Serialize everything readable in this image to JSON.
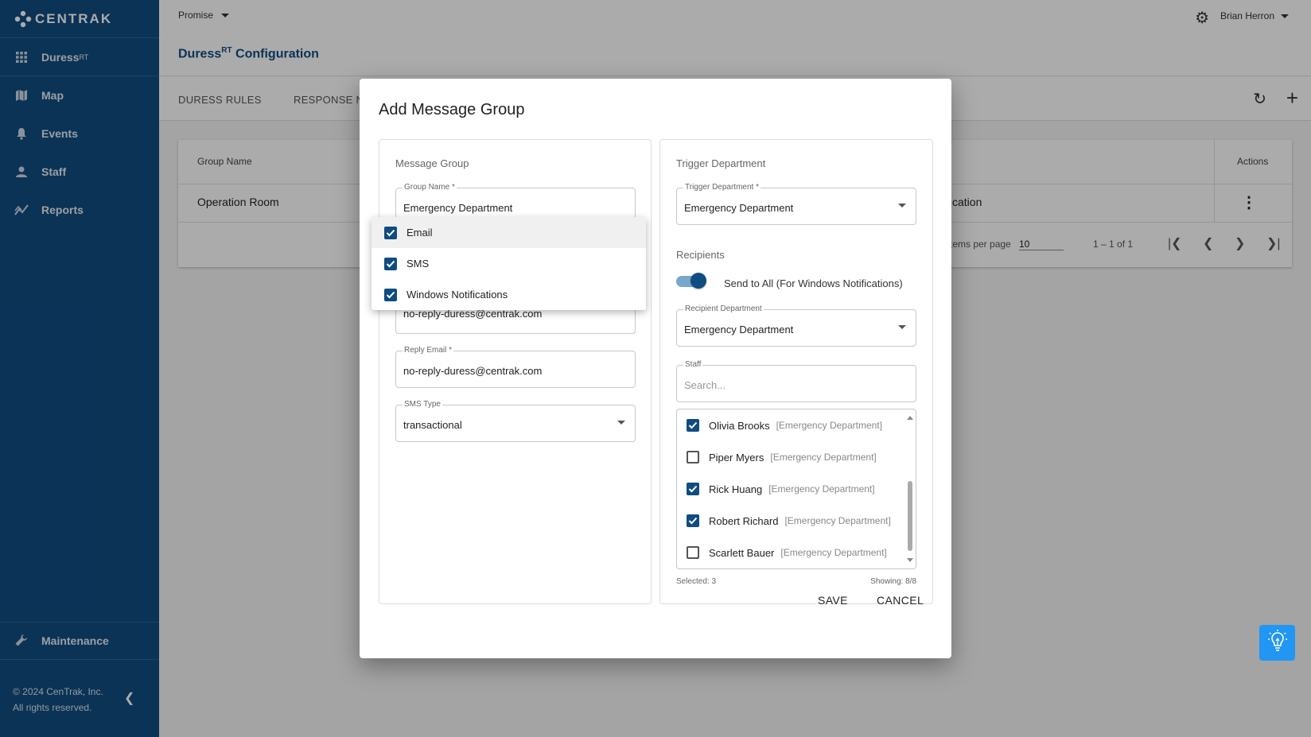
{
  "app": {
    "logo_text": "CENTRAK",
    "site": "Promise",
    "page_title": "Duress",
    "page_title_sup": "RT",
    "page_title_rest": " Configuration",
    "user": "Brian Herron"
  },
  "sidebar": {
    "items": [
      {
        "label": "Duress",
        "sup": "RT",
        "icon": "grid-icon"
      },
      {
        "label": "Map",
        "icon": "map-icon"
      },
      {
        "label": "Events",
        "icon": "bell-icon"
      },
      {
        "label": "Staff",
        "icon": "person-icon"
      },
      {
        "label": "Reports",
        "icon": "chart-icon"
      }
    ],
    "maintenance": "Maintenance",
    "copyright_line1": "© 2024 CenTrak, Inc.",
    "copyright_line2": "All rights reserved."
  },
  "tabs": [
    "DURESS RULES",
    "RESPONSE N"
  ],
  "table": {
    "headers": {
      "group_name": "Group Name",
      "actions": "Actions"
    },
    "row": {
      "group_name": "Operation Room",
      "notification_partial": "fication"
    },
    "pager": {
      "items_per_page_label": "tems per page",
      "items_per_page": "10",
      "range": "1 – 1 of 1"
    }
  },
  "dialog": {
    "title": "Add Message Group",
    "left": {
      "title": "Message Group",
      "group_name_label": "Group Name *",
      "group_name_value": "Emergency Department",
      "sender_email_value": "no-reply-duress@centrak.com",
      "reply_email_label": "Reply Email *",
      "reply_email_value": "no-reply-duress@centrak.com",
      "sms_type_label": "SMS Type",
      "sms_type_value": "transactional"
    },
    "right": {
      "title": "Trigger Department",
      "trigger_label": "Trigger Department *",
      "trigger_value": "Emergency Department",
      "recipients_title": "Recipients",
      "send_all_label": "Send to All (For Windows Notifications)",
      "send_all_on": true,
      "recipient_dept_label": "Recipient Department",
      "recipient_dept_value": "Emergency Department",
      "staff_label": "Staff",
      "staff_placeholder": "Search...",
      "staff": [
        {
          "name": "Olivia Brooks",
          "dept": "[Emergency Department]",
          "checked": true
        },
        {
          "name": "Piper Myers",
          "dept": "[Emergency Department]",
          "checked": false
        },
        {
          "name": "Rick Huang",
          "dept": "[Emergency Department]",
          "checked": true
        },
        {
          "name": "Robert Richard",
          "dept": "[Emergency Department]",
          "checked": true
        },
        {
          "name": "Scarlett Bauer",
          "dept": "[Emergency Department]",
          "checked": false
        }
      ],
      "selected": "Selected: 3",
      "showing": "Showing: 8/8"
    },
    "save": "SAVE",
    "cancel": "CANCEL"
  },
  "notify_menu": {
    "options": [
      {
        "label": "Email",
        "checked": true
      },
      {
        "label": "SMS",
        "checked": true
      },
      {
        "label": "Windows Notifications",
        "checked": true
      }
    ]
  },
  "colors": {
    "sidebar": "#0f4c81",
    "accent": "#0f4c81",
    "fab": "#2196f3"
  }
}
